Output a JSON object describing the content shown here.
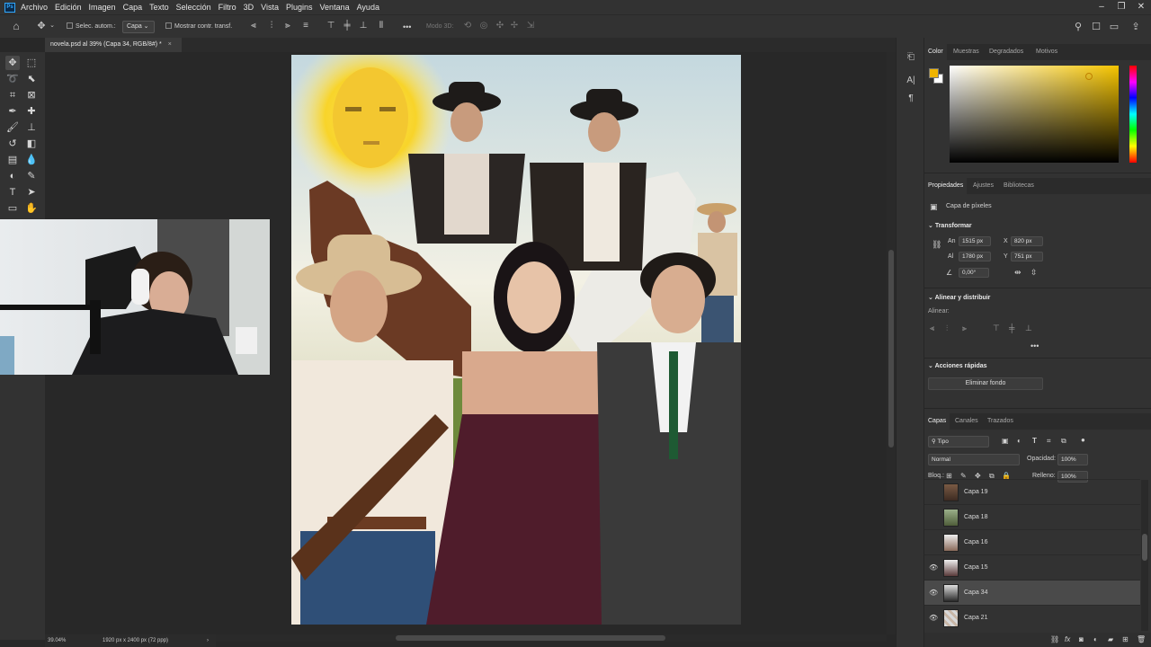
{
  "menu": {
    "logo": "Ps",
    "items": [
      "Archivo",
      "Edición",
      "Imagen",
      "Capa",
      "Texto",
      "Selección",
      "Filtro",
      "3D",
      "Vista",
      "Plugins",
      "Ventana",
      "Ayuda"
    ]
  },
  "options_bar": {
    "auto_select_label": "Selec. autom.:",
    "auto_select_value": "Capa",
    "show_transform_label": "Mostrar contr. transf.",
    "mode_3d_label": "Modo 3D:",
    "more": "•••"
  },
  "document_tab": {
    "title": "novela.psd al 39% (Capa 34, RGB/8#) *",
    "close": "×"
  },
  "status_bar": {
    "zoom": "39.04%",
    "doc_info": "1920 px x 2400 px (72 ppp)",
    "arrow": "›"
  },
  "color_panel": {
    "tabs": [
      "Color",
      "Muestras",
      "Degradados",
      "Motivos"
    ],
    "foreground_color": "#f0b400",
    "background_color": "#ffffff"
  },
  "properties_panel": {
    "tabs": [
      "Propiedades",
      "Ajustes",
      "Bibliotecas"
    ],
    "layer_type": "Capa de píxeles",
    "transform": {
      "title": "Transformar",
      "width_label": "An",
      "width": "1515 px",
      "height_label": "Al",
      "height": "1780 px",
      "x_label": "X",
      "x": "820 px",
      "y_label": "Y",
      "y": "751 px",
      "angle": "0,00°"
    },
    "align": {
      "title": "Alinear y distribuir",
      "sub": "Alinear:"
    },
    "quick_actions": {
      "title": "Acciones rápidas",
      "remove_bg": "Eliminar fondo"
    }
  },
  "layers_panel": {
    "tabs": [
      "Capas",
      "Canales",
      "Trazados"
    ],
    "filter_kind": "Tipo",
    "blend_mode": "Normal",
    "opacity_label": "Opacidad:",
    "opacity": "100%",
    "lock_label": "Bloq.:",
    "fill_label": "Relleno:",
    "fill": "100%",
    "layers": [
      {
        "name": "Capa 19",
        "visible": false,
        "selected": false
      },
      {
        "name": "Capa 18",
        "visible": false,
        "selected": false
      },
      {
        "name": "Capa 16",
        "visible": false,
        "selected": false
      },
      {
        "name": "Capa 15",
        "visible": true,
        "selected": false
      },
      {
        "name": "Capa 34",
        "visible": true,
        "selected": true
      },
      {
        "name": "Capa 21",
        "visible": true,
        "selected": false
      }
    ]
  },
  "toolbar_icons": [
    "move-tool",
    "marquee-tool",
    "lasso-tool",
    "object-select-tool",
    "crop-tool",
    "frame-tool",
    "eyedropper-tool",
    "healing-tool",
    "brush-tool",
    "stamp-tool",
    "history-brush-tool",
    "eraser-tool",
    "gradient-tool",
    "blur-tool",
    "dodge-tool",
    "pen-tool",
    "type-tool",
    "path-select-tool",
    "rectangle-tool",
    "hand-tool"
  ]
}
